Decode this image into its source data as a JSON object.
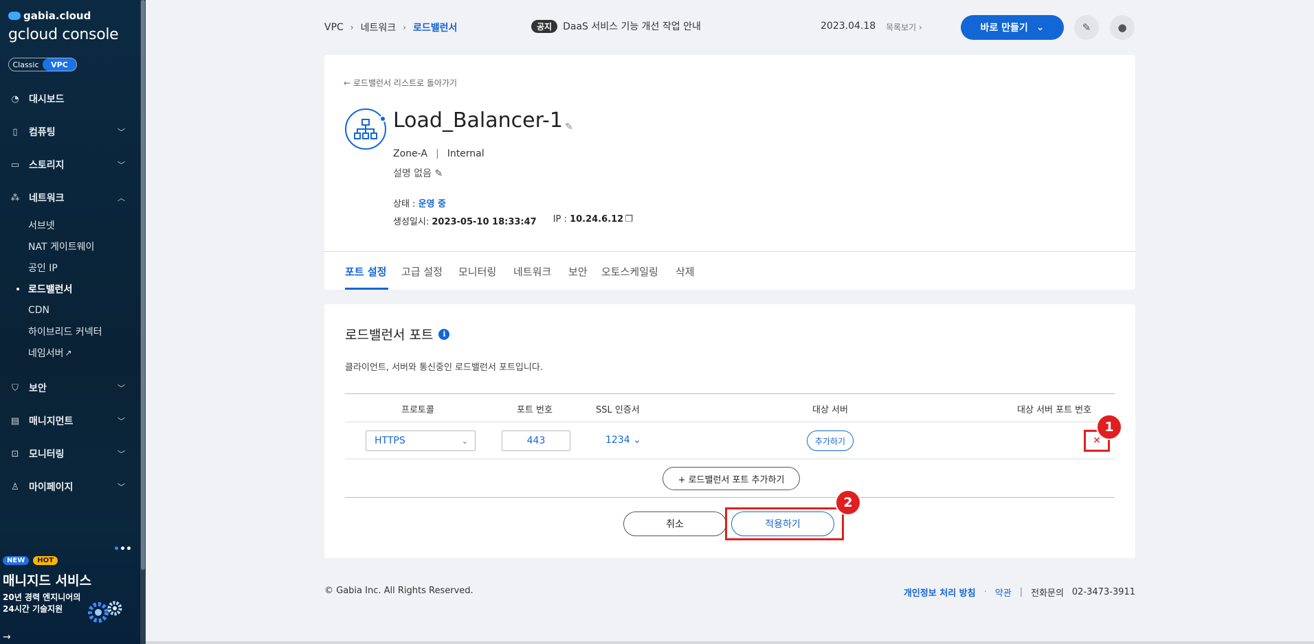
{
  "sidebar": {
    "brand_top": "gabia.cloud",
    "brand_main": "gcloud console",
    "toggle": {
      "classic": "Classic",
      "vpc": "VPC"
    },
    "items": [
      {
        "label": "대시보드",
        "icon": "dashboard-icon"
      },
      {
        "label": "컴퓨팅",
        "icon": "chip-icon"
      },
      {
        "label": "스토리지",
        "icon": "storage-icon"
      },
      {
        "label": "네트워크",
        "icon": "network-icon"
      },
      {
        "label": "보안",
        "icon": "shield-icon"
      },
      {
        "label": "매니지먼트",
        "icon": "management-icon"
      },
      {
        "label": "모니터링",
        "icon": "monitor-icon"
      },
      {
        "label": "마이페이지",
        "icon": "person-icon"
      }
    ],
    "network_sub": [
      "서브넷",
      "NAT 게이트웨이",
      "공인 IP",
      "로드밸런서",
      "CDN",
      "하이브리드 커넥터",
      "네임서버"
    ],
    "promo": {
      "badge_new": "NEW",
      "badge_hot": "HOT",
      "title": "매니지드 서비스",
      "line1": "20년 경력 엔지니어의",
      "line2": "24시간 기술지원"
    }
  },
  "topbar": {
    "breadcrumb": [
      "VPC",
      "네트워크",
      "로드밸런서"
    ],
    "notice_badge": "공지",
    "notice_text": "DaaS 서비스 기능 개선 작업 안내",
    "notice_date": "2023.04.18",
    "notice_more": "목록보기",
    "create_label": "바로 만들기"
  },
  "detail": {
    "back_link": "로드밸런서 리스트로 돌아가기",
    "name": "Load_Balancer-1",
    "zone": "Zone-A",
    "type": "Internal",
    "description": "설명 없음",
    "status_label": "상태 : ",
    "status_value": "운영 중",
    "created_label": "생성일시: ",
    "created_value": "2023-05-10 18:33:47",
    "ip_label": "IP : ",
    "ip_value": "10.24.6.12",
    "tabs": [
      "포트 설정",
      "고급 설정",
      "모니터링",
      "네트워크",
      "보안",
      "오토스케일링",
      "삭제"
    ]
  },
  "ports": {
    "title": "로드밸런서 포트",
    "description": "클라이언트, 서버와 통신중인 로드밸런서 포트입니다.",
    "headers": [
      "프로토콜",
      "포트 번호",
      "SSL 인증서",
      "대상 서버",
      "대상 서버 포트 번호"
    ],
    "row": {
      "protocol": "HTTPS",
      "port": "443",
      "ssl": "1234",
      "target_add": "추가하기"
    },
    "add_port": "+ 로드밸런서 포트 추가하기",
    "cancel": "취소",
    "apply": "적용하기",
    "markers": [
      "1",
      "2"
    ]
  },
  "footer": {
    "copyright": "© Gabia Inc. All Rights Reserved.",
    "privacy": "개인정보 처리 방침",
    "dot": "·",
    "terms": "약관",
    "bar": "|",
    "phone_label": "전화문의",
    "phone": "02-3473-3911"
  },
  "colors": {
    "accent": "#1266d6",
    "highlight": "#e02020",
    "sidebar": "#0b2a42"
  }
}
